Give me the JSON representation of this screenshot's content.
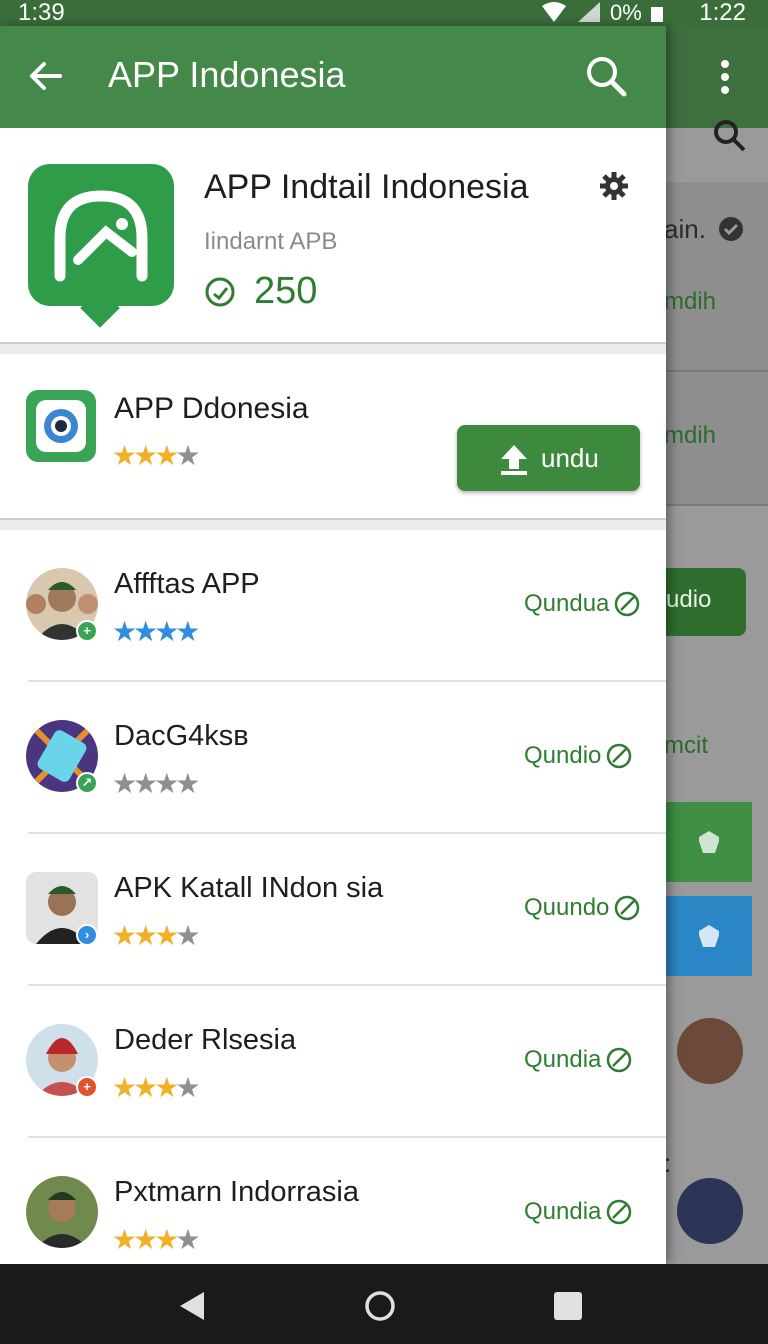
{
  "status_bar": {
    "time_left": "1:39",
    "battery_text": "0%",
    "time_right": "1:22"
  },
  "app_bar": {
    "title": "APP Indonesia"
  },
  "app_header": {
    "name": "APP Indtail Indonesia",
    "subtitle": "Iindarnt APB",
    "count": "250"
  },
  "featured": {
    "name": "APP Ddonesia",
    "rating": 3,
    "button_label": "undu"
  },
  "list": [
    {
      "name": "Affftas APP",
      "rating": 4,
      "star_color": "#2f8ee0",
      "action": "Qundua",
      "badge_color": "#3aa456"
    },
    {
      "name": "DacG4ksв",
      "rating": 0,
      "star_color": "#8f8f8f",
      "action": "Qundio",
      "badge_color": "#3aa456"
    },
    {
      "name": "APK Katall INdon sia",
      "rating": 3,
      "star_color": "#f0b12a",
      "action": "Quundo",
      "badge_color": "#2f8ee0"
    },
    {
      "name": "Deder Rlsesia",
      "rating": 3,
      "star_color": "#f0b12a",
      "action": "Qundia",
      "badge_color": "#e0542c"
    },
    {
      "name": "Pxtmarn Indorrasia",
      "rating": 3,
      "star_color": "#f0b12a",
      "action": "Qundia",
      "badge_color": "#3aa456"
    }
  ],
  "background": {
    "text_1": "ain.",
    "text_2": "mdih",
    "text_3": "mdih",
    "button": "udio",
    "text_4": "mcit",
    "text_5": ":"
  },
  "colors": {
    "primary": "#44884a",
    "accent": "#2f7d32",
    "star": "#f0b12a"
  }
}
